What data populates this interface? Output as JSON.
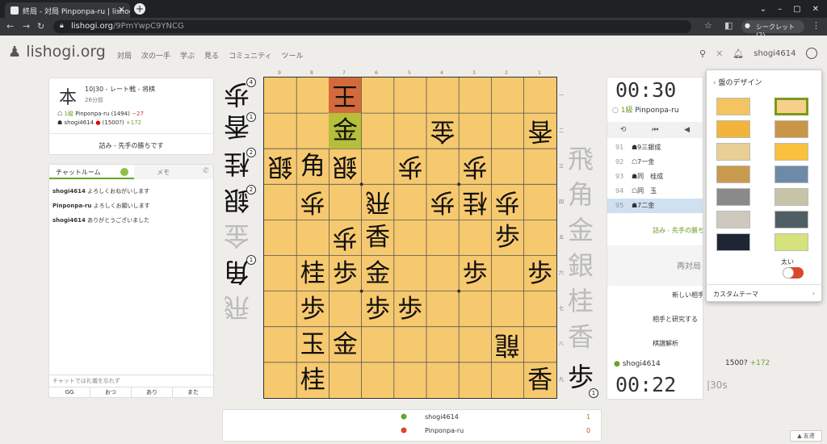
{
  "browser": {
    "tab_title": "終局 - 対局 Pinponpa-ru | lishogi",
    "url_host": "lishogi.org",
    "url_path": "/9PmYwpC9YNCG",
    "incognito_label": "シークレット (2)"
  },
  "site": {
    "logo": "lishogi.org",
    "nav": [
      "対局",
      "次の一手",
      "学ぶ",
      "見る",
      "コミュニティ",
      "ツール"
    ],
    "username": "shogi4614"
  },
  "game_info": {
    "kanji": "本",
    "type_line": "10|30 - レート戦 - 将棋",
    "time_ago": "26分前",
    "player1_rank": "1級",
    "player1_name": "Pinponpa-ru (1494)",
    "player1_diff": "−27",
    "player2_name": "shogi4614",
    "player2_rating": "(1500?)",
    "player2_diff": "+172",
    "result": "詰み - 先手の勝ちです"
  },
  "chat": {
    "tab_chat": "チャットルーム",
    "tab_notes": "メモ",
    "messages": [
      {
        "user": "shogi4614",
        "text": "よろしくおねがいします"
      },
      {
        "user": "Pinponpa-ru",
        "text": "よろしくお願いします"
      },
      {
        "user": "shogi4614",
        "text": "ありがとうございました"
      }
    ],
    "placeholder": "チャットでは礼儀を忘れず",
    "presets": [
      "GG",
      "おつ",
      "あり",
      "また"
    ]
  },
  "board": {
    "files": [
      "9",
      "8",
      "7",
      "6",
      "5",
      "4",
      "3",
      "2",
      "1"
    ],
    "ranks": [
      "一",
      "二",
      "三",
      "四",
      "五",
      "六",
      "七",
      "八",
      "九"
    ],
    "highlight_last_from": "#b5bf3a",
    "highlight_king": "#d46a3c"
  },
  "hands": {
    "gote": [
      {
        "piece": "歩",
        "count": "4"
      },
      {
        "piece": "香",
        "count": "1"
      },
      {
        "piece": "桂",
        "count": "2"
      },
      {
        "piece": "銀",
        "count": "2"
      },
      {
        "piece": "金",
        "count": ""
      },
      {
        "piece": "角",
        "count": "1"
      },
      {
        "piece": "飛",
        "count": ""
      }
    ],
    "sente": [
      {
        "piece": "飛",
        "count": ""
      },
      {
        "piece": "角",
        "count": ""
      },
      {
        "piece": "金",
        "count": ""
      },
      {
        "piece": "銀",
        "count": ""
      },
      {
        "piece": "桂",
        "count": ""
      },
      {
        "piece": "香",
        "count": ""
      },
      {
        "piece": "歩",
        "count": "1"
      }
    ]
  },
  "right_panel": {
    "clock_top": "00:30",
    "top_player_rank": "1級",
    "top_player": "Pinponpa-ru",
    "moves": [
      {
        "num": "91",
        "text": "9三銀成"
      },
      {
        "num": "92",
        "text": "7一金"
      },
      {
        "num": "93",
        "text": "同　桂成"
      },
      {
        "num": "94",
        "text": "同　玉"
      },
      {
        "num": "95",
        "text": "7二金"
      }
    ],
    "result": "詰み - 先手の勝ち",
    "rematch": "再対局",
    "new_opponent": "新しい相手",
    "study": "相手と研究する",
    "analysis": "棋譜解析",
    "bottom_player": "shogi4614",
    "bottom_rating": "1500?",
    "bottom_diff": "+172",
    "clock_bottom": "00:22",
    "increment": "|30s"
  },
  "dropdown": {
    "title": "盤のデザイン",
    "thick_label": "太い",
    "custom_theme": "カスタムテーマ",
    "swatches": [
      "#f3c460",
      "#f6d08a",
      "#f2b43a",
      "#c99547",
      "#e9cf95",
      "#f9c13d",
      "#c89a4e",
      "#6f8aa8",
      "#8a8a8a",
      "#c7c3a6",
      "#cfc8bf",
      "#4f5e64",
      "#1e2636",
      "#d6e27b"
    ]
  },
  "scoreboard": {
    "rows": [
      {
        "name": "shogi4614",
        "score": "1",
        "color": "#6aa329"
      },
      {
        "name": "Pinponpa-ru",
        "score": "0",
        "color": "#d9482b"
      }
    ]
  },
  "friends": "友達"
}
